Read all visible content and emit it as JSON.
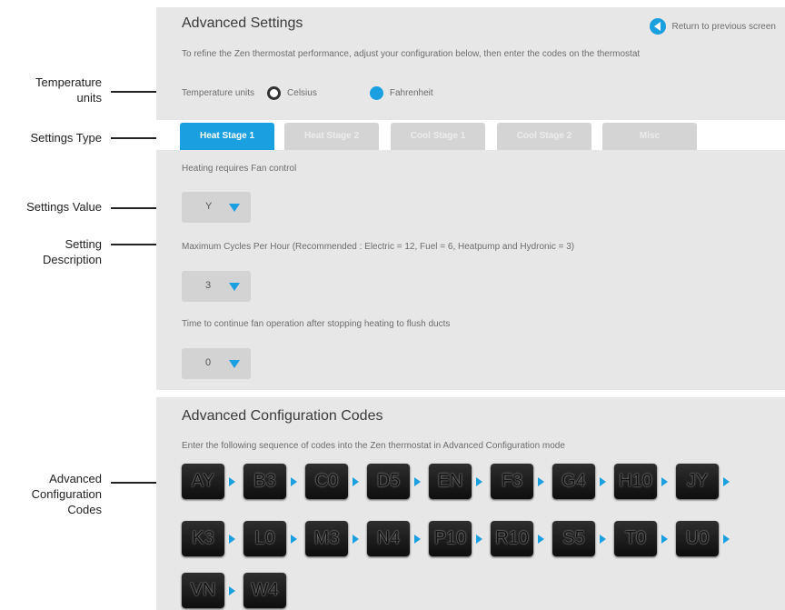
{
  "annotations": {
    "temperature_units": [
      "Temperature",
      "units"
    ],
    "settings_type": "Settings Type",
    "settings_value": "Settings Value",
    "setting_description": [
      "Setting",
      "Description"
    ],
    "advanced_codes": [
      "Advanced",
      "Configuration",
      "Codes"
    ]
  },
  "settings": {
    "title": "Advanced Settings",
    "return_link": "Return to previous screen",
    "intro": "To refine the Zen thermostat performance, adjust your configuration below, then enter the codes on the thermostat",
    "temperature_label": "Temperature units",
    "units": [
      {
        "label": "Celsius",
        "selected": false
      },
      {
        "label": "Fahrenheit",
        "selected": true
      }
    ],
    "tabs": [
      "Heat Stage 1",
      "Heat Stage 2",
      "Cool Stage 1",
      "Cool Stage 2",
      "Misc"
    ],
    "active_tab": "Heat Stage 1",
    "fields": [
      {
        "description": "Heating requires Fan control",
        "value": "Y"
      },
      {
        "description": "Maximum Cycles Per Hour (Recommended : Electric = 12, Fuel = 6, Heatpump and Hydronic = 3)",
        "value": "3"
      },
      {
        "description": "Time to continue fan operation after stopping heating to flush ducts",
        "value": "0"
      }
    ]
  },
  "codes": {
    "title": "Advanced Configuration Codes",
    "instruction": "Enter the following sequence of codes into the Zen thermostat in Advanced Configuration mode",
    "items": [
      "AY",
      "B3",
      "C0",
      "D5",
      "EN",
      "F3",
      "G4",
      "H10",
      "JY",
      "K3",
      "L0",
      "M3",
      "N4",
      "P10",
      "R10",
      "S5",
      "T0",
      "U0",
      "VN",
      "W4"
    ]
  },
  "colors": {
    "accent": "#1a9fe0",
    "panel": "#e7e7e7"
  }
}
